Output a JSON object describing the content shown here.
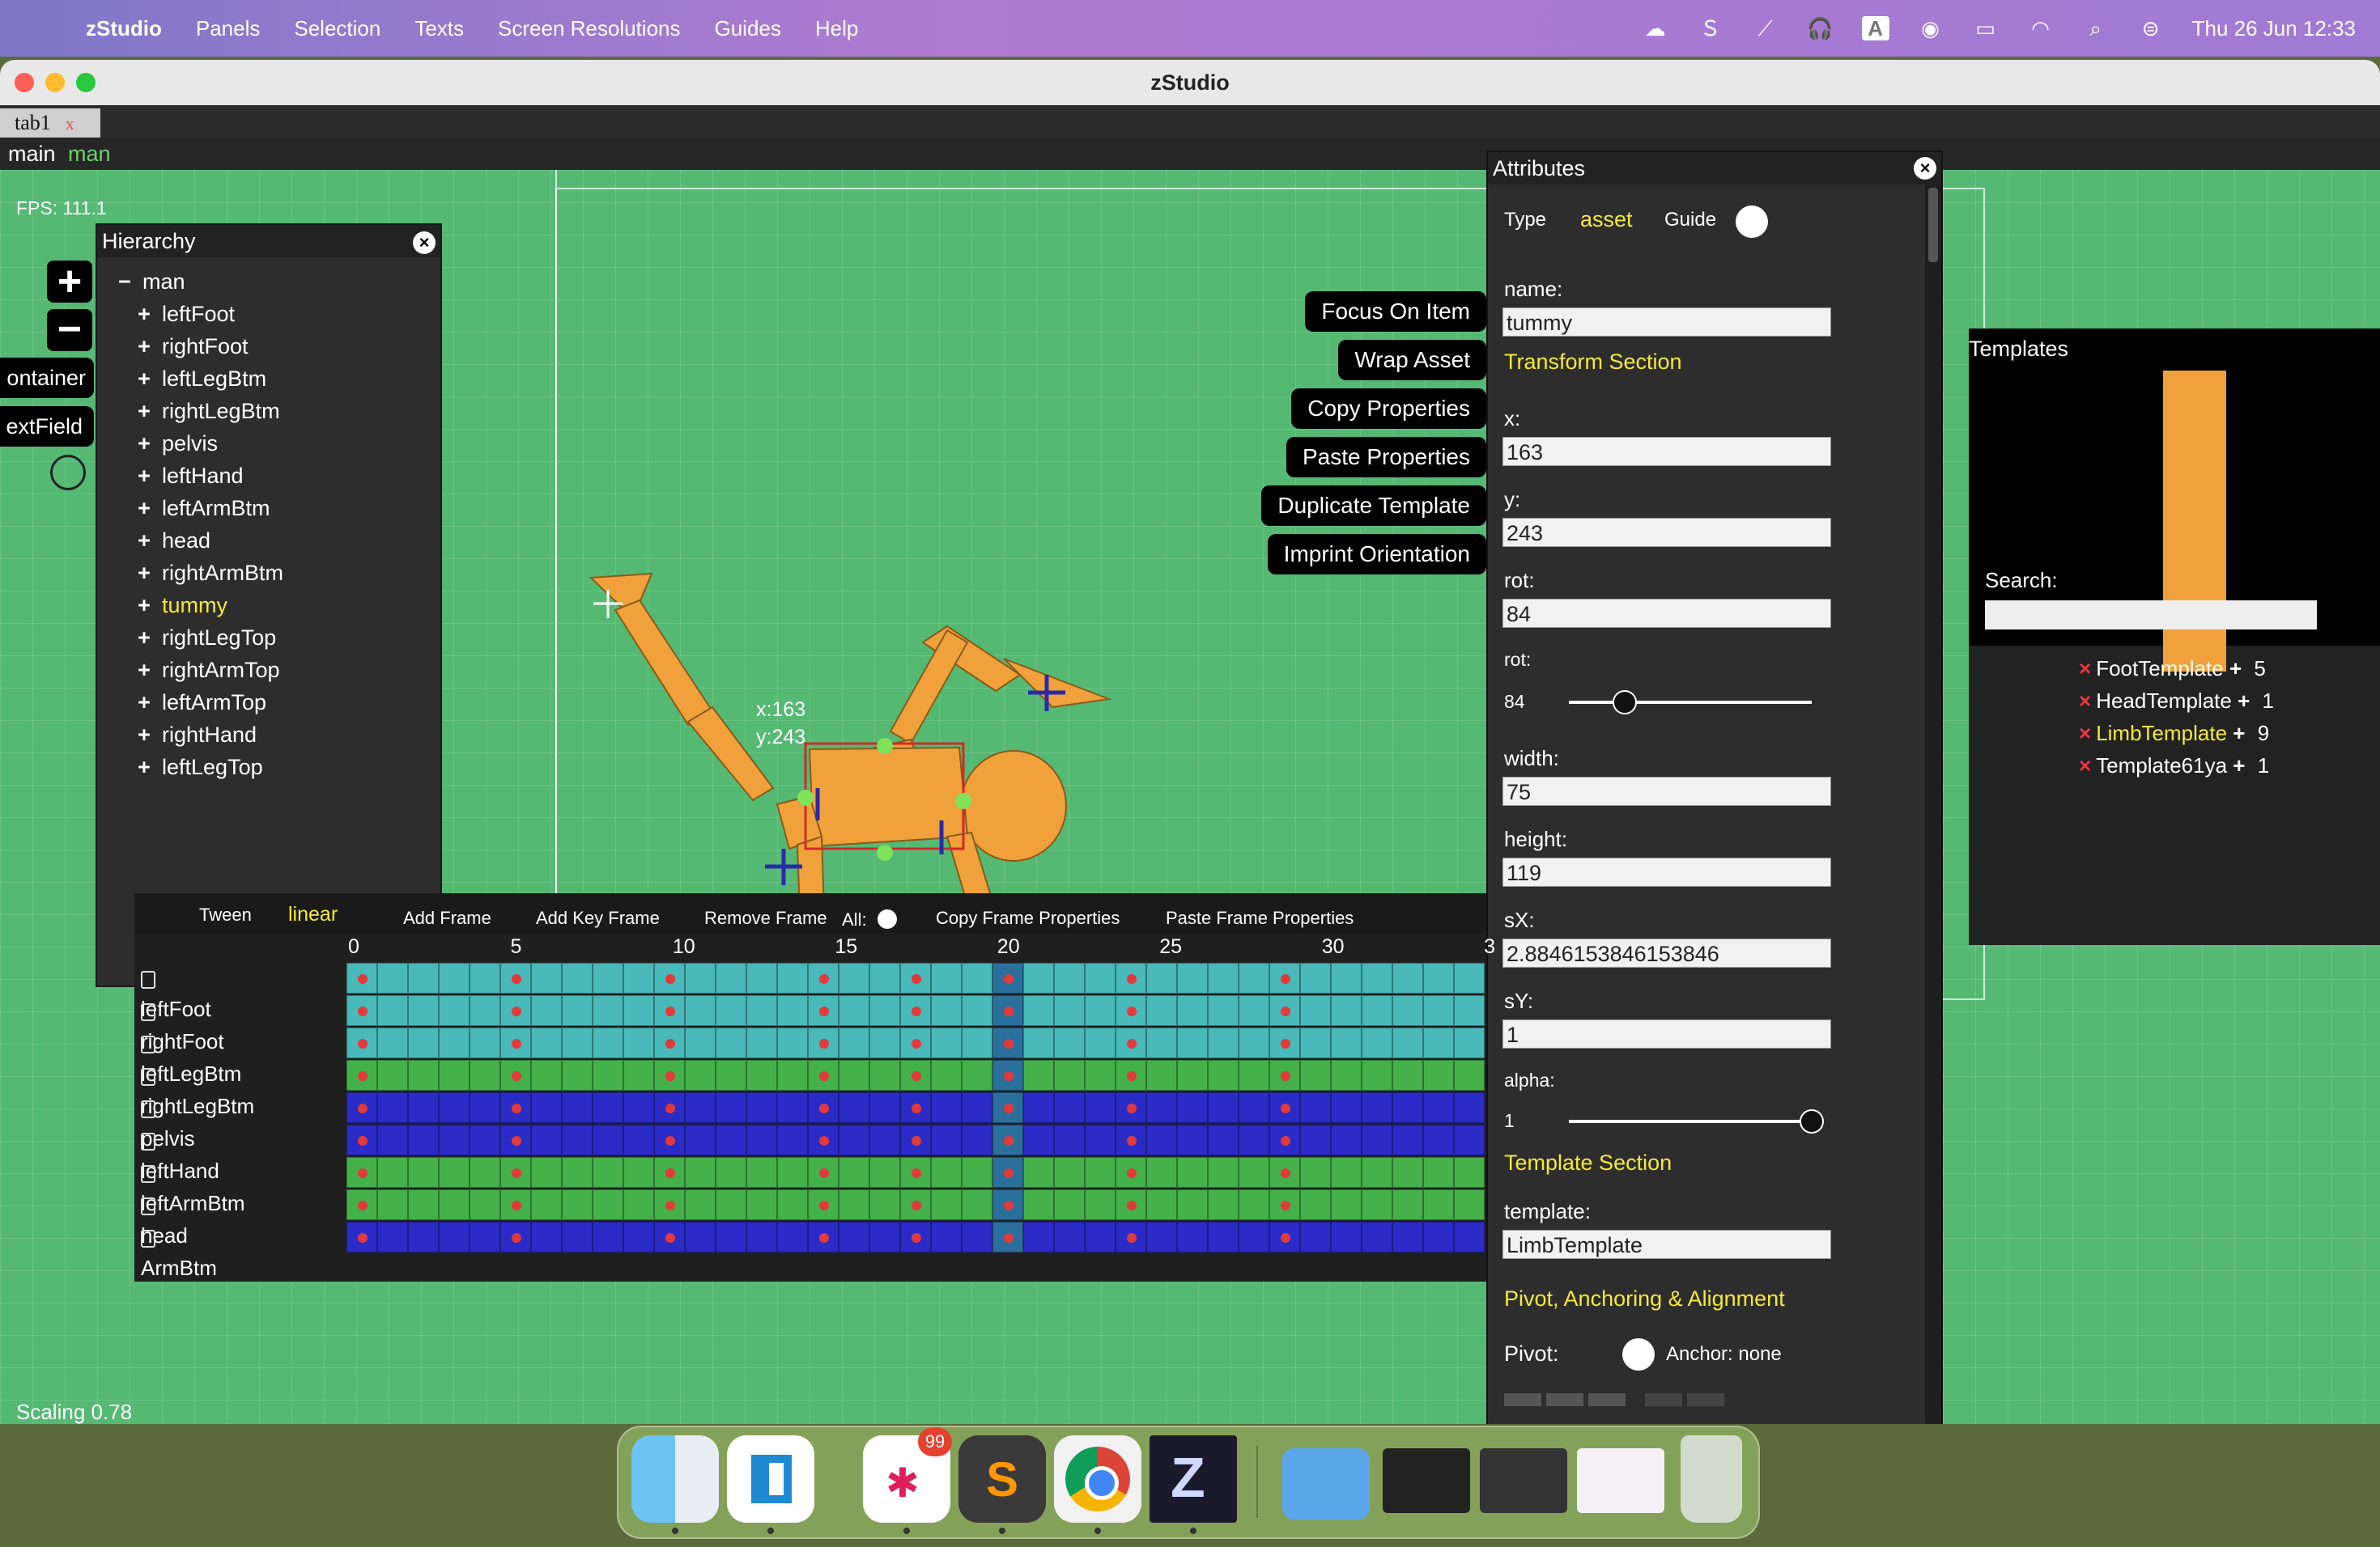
{
  "menubar": {
    "app_name": "zStudio",
    "items": [
      "Panels",
      "Selection",
      "Texts",
      "Screen Resolutions",
      "Guides",
      "Help"
    ],
    "status_badge_text": "A",
    "clock": "Thu 26 Jun  12:33"
  },
  "window": {
    "title": "zStudio",
    "tab_label": "tab1",
    "tab_close": "x",
    "breadcrumb": {
      "root": "main",
      "current": "man"
    }
  },
  "canvas": {
    "fps": "FPS: 111.1",
    "scaling": "Scaling 0.78",
    "coord_x": "x:163",
    "coord_y": "y:243",
    "side_buttons": {
      "zoom_in": "+",
      "zoom_out": "−",
      "container": "ontainer",
      "textfield": "extField"
    }
  },
  "hierarchy": {
    "title": "Hierarchy",
    "root": "man",
    "items": [
      "leftFoot",
      "rightFoot",
      "leftLegBtm",
      "rightLegBtm",
      "pelvis",
      "leftHand",
      "leftArmBtm",
      "head",
      "rightArmBtm",
      "tummy",
      "rightLegTop",
      "rightArmTop",
      "leftArmTop",
      "rightHand",
      "leftLegTop"
    ],
    "selected": "tummy"
  },
  "action_buttons": [
    "Focus On Item",
    "Wrap Asset",
    "Copy Properties",
    "Paste Properties",
    "Duplicate Template",
    "Imprint Orientation"
  ],
  "attributes": {
    "title": "Attributes",
    "type_label": "Type",
    "type_value": "asset",
    "guide_label": "Guide",
    "name_label": "name:",
    "name_value": "tummy",
    "transform_section": "Transform Section",
    "x_label": "x:",
    "x_value": "163",
    "y_label": "y:",
    "y_value": "243",
    "rot_label": "rot:",
    "rot_value": "84",
    "rot_slider_label": "rot:",
    "rot_slider_value": "84",
    "rot_slider_fraction": 0.23,
    "width_label": "width:",
    "width_value": "75",
    "height_label": "height:",
    "height_value": "119",
    "sx_label": "sX:",
    "sx_value": "2.8846153846153846",
    "sy_label": "sY:",
    "sy_value": "1",
    "alpha_label": "alpha:",
    "alpha_value": "1",
    "alpha_fraction": 1.0,
    "template_section": "Template Section",
    "template_label": "template:",
    "template_value": "LimbTemplate",
    "pivot_section": "Pivot, Anchoring & Alignment",
    "pivot_label": "Pivot:",
    "anchor_text": "Anchor: none"
  },
  "templates": {
    "title": "Templates",
    "search_label": "Search:",
    "search_value": "",
    "items": [
      {
        "name": "FootTemplate",
        "count": "5"
      },
      {
        "name": "HeadTemplate",
        "count": "1"
      },
      {
        "name": "LimbTemplate",
        "count": "9"
      },
      {
        "name": "Template61ya",
        "count": "1"
      }
    ],
    "selected": "LimbTemplate"
  },
  "timeline": {
    "tween_label": "Tween",
    "tween_value": "linear",
    "add_frame": "Add Frame",
    "add_key_frame": "Add Key Frame",
    "remove_frame": "Remove Frame",
    "all_label": "All:",
    "copy_frame_props": "Copy Frame Properties",
    "paste_frame_props": "Paste Frame Properties",
    "ticks": [
      "0",
      "5",
      "10",
      "15",
      "20",
      "25",
      "30",
      "3"
    ],
    "rows": [
      "leftFoot",
      "rightFoot",
      "leftLegBtm",
      "rightLegBtm",
      "pelvis",
      "leftHand",
      "leftArmBtm",
      "head",
      "ArmBtm"
    ],
    "keyframes": [
      0,
      5,
      10,
      15,
      18,
      21,
      25,
      30
    ],
    "current_frame": 21
  },
  "dock": {
    "slack_badge": "99",
    "apps": [
      "finder-icon",
      "vscode-icon",
      "slack-icon",
      "sublime-icon",
      "chrome-icon",
      "zstudio-icon",
      "folder-icon",
      "terminal-vscode-window",
      "terminal-sublime-window",
      "slack-window",
      "trash-icon"
    ]
  },
  "colors": {
    "accent_yellow": "#f5e93a",
    "canvas_green": "#55b974",
    "figure_orange": "#f0a13b",
    "timeline_teal": "#49b9b9",
    "timeline_blue": "#2b2bc8"
  }
}
